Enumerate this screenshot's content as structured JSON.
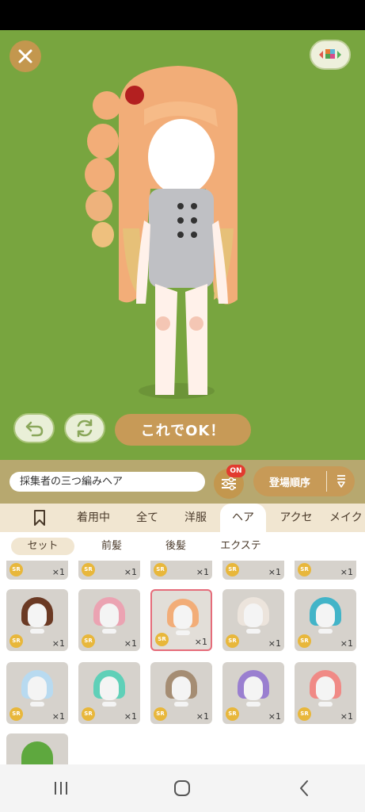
{
  "stage": {
    "ok_label": "これでOK！"
  },
  "item_name": "採集者の三つ編みヘア",
  "filter_badge": "ON",
  "sort_label": "登場順序",
  "tabs": [
    "着用中",
    "全て",
    "洋服",
    "ヘア",
    "アクセ",
    "メイク"
  ],
  "active_tab": "ヘア",
  "subtabs": [
    "セット",
    "前髪",
    "後髪",
    "エクステ"
  ],
  "active_subtab": "セット",
  "rarity": "SR",
  "quantity": "×1",
  "colors": {
    "stage_bg": "#78a53f",
    "accent": "#c79a57",
    "badge": "#e23b2f",
    "selected_border": "#e56c7a"
  },
  "icons": [
    "close-icon",
    "palette-icon",
    "undo-icon",
    "rotate-icon",
    "filter-icon",
    "sort-icon",
    "bookmark-icon",
    "recent-apps-icon",
    "home-icon",
    "back-icon"
  ]
}
